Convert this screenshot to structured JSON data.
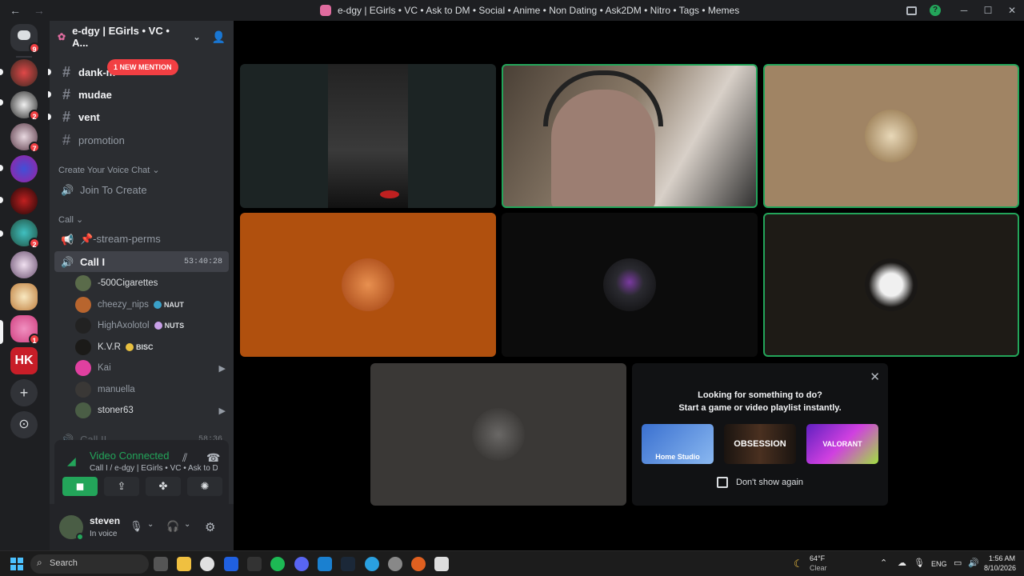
{
  "window": {
    "title": "e-dgy | EGirls • VC • Ask to DM • Social • Anime • Non Dating • Ask2DM • Nitro • Tags • Memes",
    "back": "←",
    "forward": "→",
    "minimize": "─",
    "maximize": "☐",
    "close": "✕",
    "help": "?"
  },
  "guilds": {
    "home_badge": "9",
    "badges": [
      "2",
      "7",
      "2",
      "1"
    ],
    "add": "+",
    "discover": "⊙"
  },
  "server": {
    "name": "e-dgy | EGirls • VC • A...",
    "chevron": "⌄",
    "invite": "👤"
  },
  "channels": {
    "partial_top": "·",
    "dank": "dank-m",
    "mention_pill": "1 NEW MENTION",
    "mudae": "mudae",
    "vent": "vent",
    "promotion": "promotion",
    "hash": "#"
  },
  "categories": {
    "voice": "Create Your Voice Chat ⌄",
    "call": "Call ⌄"
  },
  "voice_channels": {
    "join": "Join To Create",
    "stream_perms": "📌-stream-perms",
    "call_1": "Call I",
    "call_1_timer": "53:40:28",
    "call_2": "Call II",
    "call_2_timer": "58:36",
    "speaker": "🔊"
  },
  "voice_users": [
    {
      "name": "-500Cigarettes",
      "tag": "",
      "color": "#5a6b4a",
      "bright": true,
      "cam": false
    },
    {
      "name": "cheezy_nips",
      "tag": "NAUT",
      "tag_color": "#3aa0c8",
      "color": "#b8652e",
      "bright": false,
      "cam": false
    },
    {
      "name": "HighAxolotol",
      "tag": "NUTS",
      "tag_color": "#c8a0e8",
      "color": "#222222",
      "bright": false,
      "cam": false
    },
    {
      "name": "K.V.R",
      "tag": "BISC",
      "tag_color": "#e8c040",
      "color": "#1b1a18",
      "bright": true,
      "cam": false
    },
    {
      "name": "Kai",
      "tag": "",
      "color": "#e040a0",
      "bright": false,
      "cam": true
    },
    {
      "name": "manuella",
      "tag": "",
      "color": "#3a3836",
      "bright": false,
      "cam": false
    },
    {
      "name": "stoner63",
      "tag": "",
      "color": "#4a5d45",
      "bright": true,
      "cam": true
    }
  ],
  "cam_icon": "▶",
  "voice_panel": {
    "status": "Video Connected",
    "sub": "Call I / e-dgy | EGirls • VC • Ask to D...",
    "signal": "◢",
    "noise": "⫽",
    "hangup": "☎",
    "buttons": [
      "◼",
      "⇪",
      "✤",
      "✺"
    ]
  },
  "user": {
    "name": "steven",
    "status": "In voice",
    "mic": "🎙",
    "headset": "🎧",
    "settings": "⚙",
    "caret": "⌄"
  },
  "promo": {
    "line1": "Looking for something to do?",
    "line2": "Start a game or video playlist instantly.",
    "close": "✕",
    "cards": [
      "Home Studio",
      "OBSESSION",
      "VALORANT"
    ],
    "checkbox": "Don't show again"
  },
  "taskbar": {
    "search": "Search",
    "weather_temp": "64°F",
    "weather_cond": "Clear",
    "lang": "ENG",
    "time": "1:56 AM",
    "date": "8/10/2026",
    "chevron": "⌃"
  },
  "colors": {
    "accent_green": "#23a55a",
    "mention_red": "#f23f43",
    "bg_dark": "#1e1f22",
    "sidebar": "#2b2d31"
  }
}
